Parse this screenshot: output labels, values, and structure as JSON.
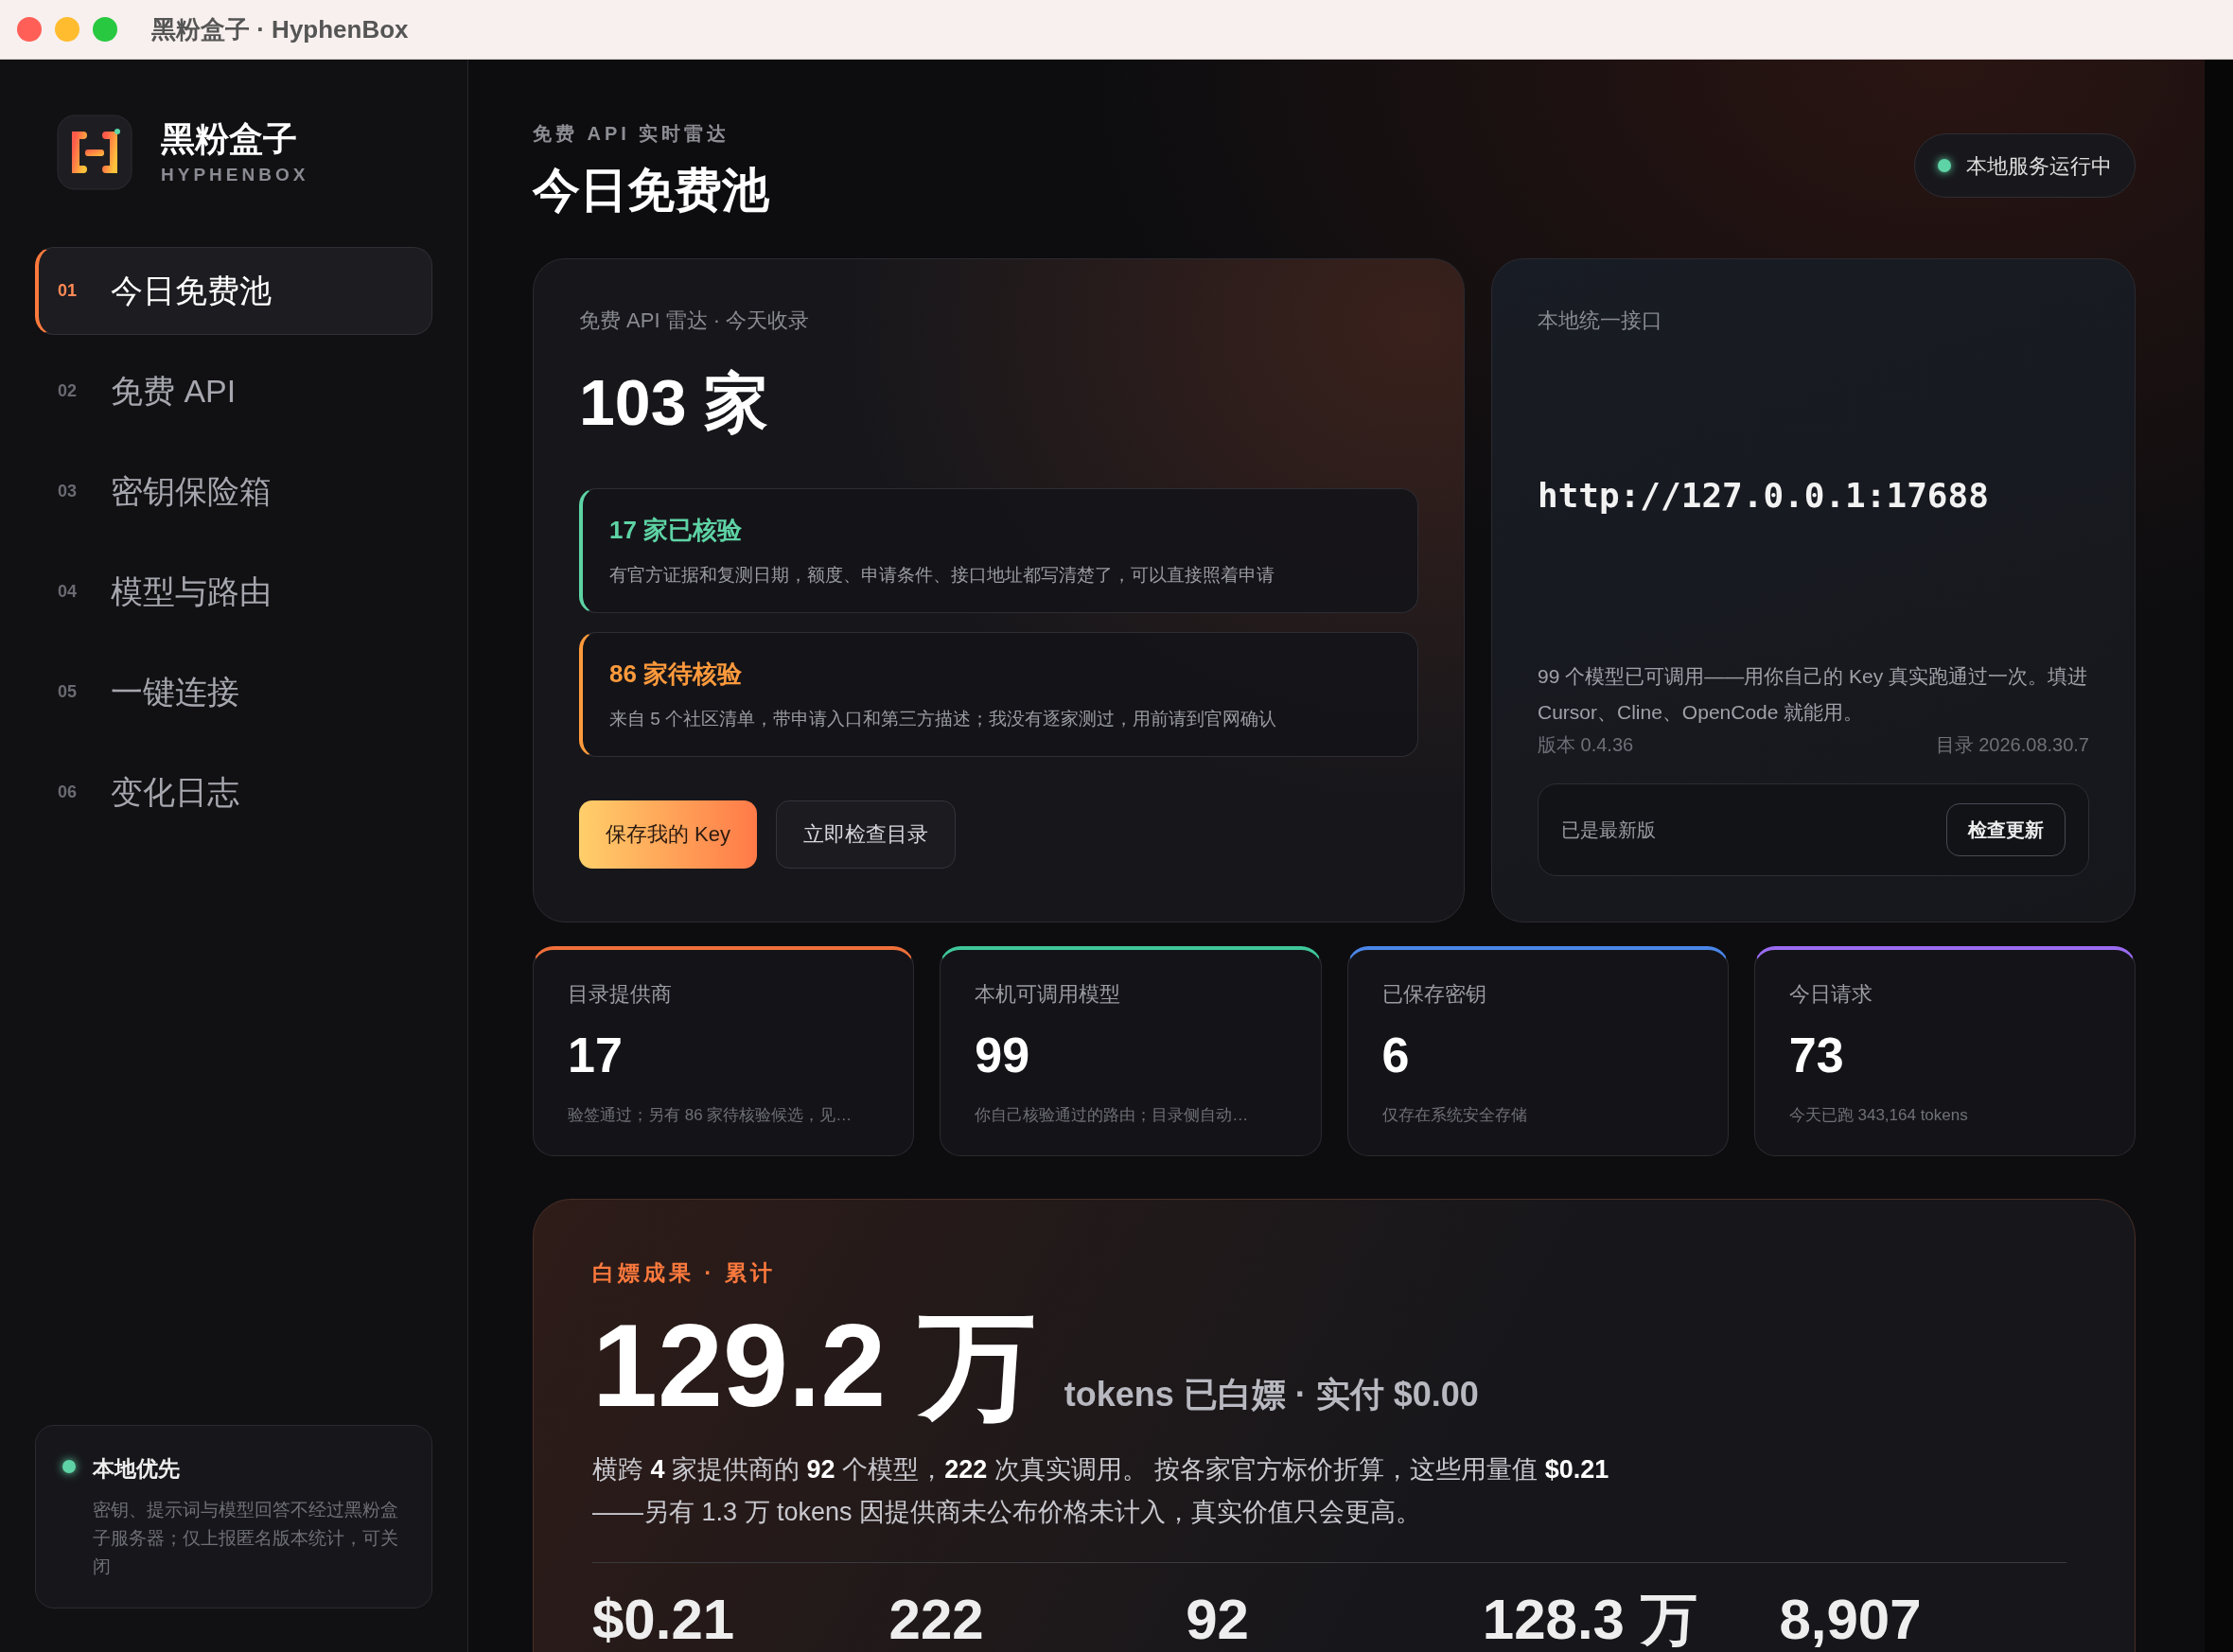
{
  "window": {
    "title": "黑粉盒子 · HyphenBox"
  },
  "sidebar": {
    "brand": {
      "name": "黑粉盒子",
      "subtitle": "HYPHENBOX"
    },
    "nav": [
      {
        "number": "01",
        "label": "今日免费池",
        "selected": true
      },
      {
        "number": "02",
        "label": "免费 API",
        "selected": false
      },
      {
        "number": "03",
        "label": "密钥保险箱",
        "selected": false
      },
      {
        "number": "04",
        "label": "模型与路由",
        "selected": false
      },
      {
        "number": "05",
        "label": "一键连接",
        "selected": false
      },
      {
        "number": "06",
        "label": "变化日志",
        "selected": false
      }
    ],
    "notice": {
      "title": "本地优先",
      "text": "密钥、提示词与模型回答不经过黑粉盒子服务器；仅上报匿名版本统计，可关闭"
    }
  },
  "header": {
    "eyebrow": "免费 API 实时雷达",
    "title": "今日免费池",
    "status": {
      "label": "本地服务运行中"
    }
  },
  "radar_card": {
    "caption": "免费 API 雷达 · 今天收录",
    "count": "103 家",
    "groups": [
      {
        "color": "#5ed3a5",
        "title": "17 家已核验",
        "text": "有官方证据和复测日期，额度、申请条件、接口地址都写清楚了，可以直接照着申请"
      },
      {
        "color": "#ff9a3c",
        "title": "86 家待核验",
        "text": "来自 5 个社区清单，带申请入口和第三方描述；我没有逐家测过，用前请到官网确认"
      }
    ],
    "buttons": [
      {
        "kind": "primary",
        "label": "保存我的 Key"
      },
      {
        "kind": "secondary",
        "label": "立即检查目录"
      }
    ]
  },
  "endpoint_card": {
    "caption": "本地统一接口",
    "url": "http://127.0.0.1:17688",
    "description": "99 个模型已可调用——用你自己的 Key 真实跑通过一次。填进 Cursor、Cline、OpenCode 就能用。",
    "version": "版本 0.4.36",
    "catalog": "目录 2026.08.30.7",
    "update": {
      "status": "已是最新版",
      "button": "检查更新"
    }
  },
  "stats": [
    {
      "label": "目录提供商",
      "value": "17",
      "note": "验签通过；另有 86 家待核验候选，见…",
      "color": "#f0703a"
    },
    {
      "label": "本机可调用模型",
      "value": "99",
      "note": "你自己核验通过的路由；目录侧自动…",
      "color": "#3fc79a"
    },
    {
      "label": "已保存密钥",
      "value": "6",
      "note": "仅存在系统安全存储",
      "color": "#4a86e8"
    },
    {
      "label": "今日请求",
      "value": "73",
      "note": "今天已跑 343,164 tokens",
      "color": "#9a6cf0"
    }
  ],
  "savings": {
    "eyebrow": "白嫖成果 · 累计",
    "amount": "129.2 万",
    "amount_note": "tokens 已白嫖 · 实付 $0.00",
    "summary": "横跨 **4** 家提供商的 **92** 个模型，**222** 次真实调用。 按各家官方标价折算，这些用量值 **$0.21**\n——另有 1.3 万 tokens 因提供商未公布价格未计入，真实价值只会更高。",
    "figures": [
      "$0.21",
      "222",
      "92",
      "128.3 万",
      "8,907"
    ]
  }
}
